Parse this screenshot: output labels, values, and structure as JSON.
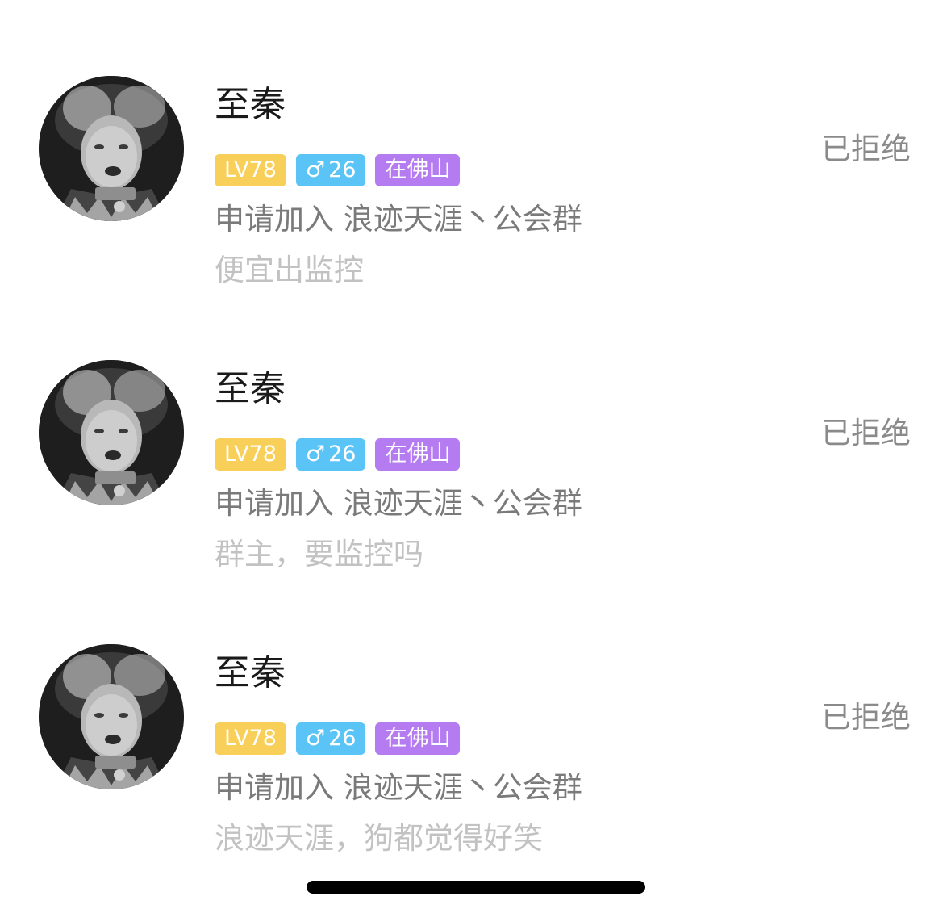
{
  "requests": [
    {
      "name": "至秦",
      "level": "LV78",
      "gender_symbol": "♂",
      "age": "26",
      "city": "在佛山",
      "request_text": "申请加入 浪迹天涯丶公会群",
      "message": "便宜出监控",
      "status": "已拒绝"
    },
    {
      "name": "至秦",
      "level": "LV78",
      "gender_symbol": "♂",
      "age": "26",
      "city": "在佛山",
      "request_text": "申请加入 浪迹天涯丶公会群",
      "message": "群主，要监控吗",
      "status": "已拒绝"
    },
    {
      "name": "至秦",
      "level": "LV78",
      "gender_symbol": "♂",
      "age": "26",
      "city": "在佛山",
      "request_text": "申请加入 浪迹天涯丶公会群",
      "message": "浪迹天涯，狗都觉得好笑",
      "status": "已拒绝"
    }
  ],
  "colors": {
    "level_badge": "#f7cf59",
    "gender_badge": "#5bc4f6",
    "city_badge": "#b57bf1",
    "status_text": "#8a8a8a"
  },
  "icons": {
    "avatar": "avatar-photo-icon",
    "gender": "male-icon"
  }
}
